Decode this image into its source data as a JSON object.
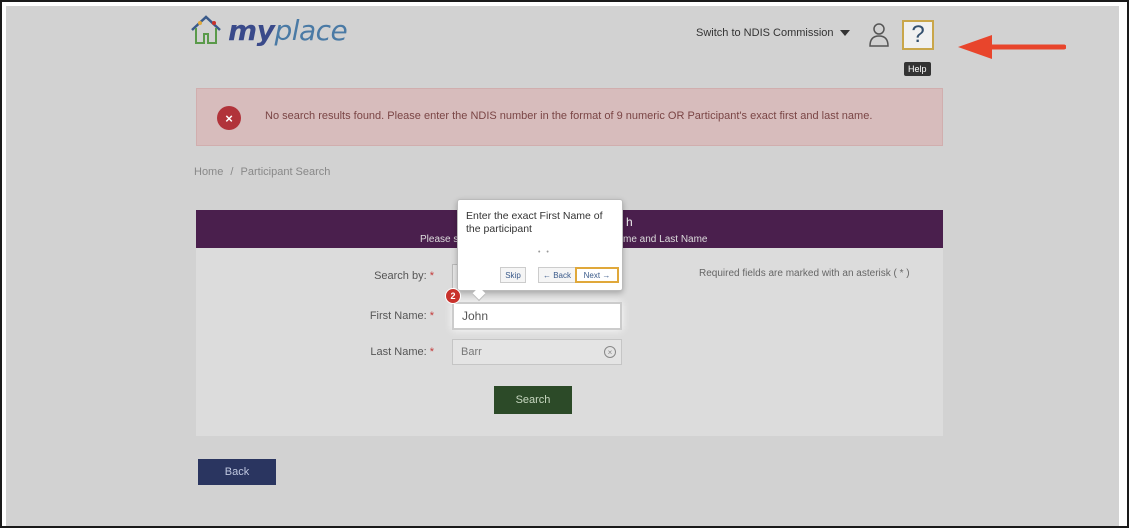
{
  "header": {
    "logo_prefix": "my",
    "logo_suffix": "place",
    "switch_label": "Switch to NDIS Commission",
    "help_symbol": "?",
    "help_tooltip": "Help",
    "user_icon": "user-icon",
    "annotation_arrow_color": "#e8452c"
  },
  "alert": {
    "icon": "×",
    "message": "No search results found. Please enter the NDIS number in the format of 9 numeric OR Participant's exact first and last name."
  },
  "breadcrumb": {
    "home": "Home",
    "separator": "/",
    "current": "Participant Search"
  },
  "card": {
    "header_title_fragment": "h",
    "header_sub_left": "Please se",
    "header_sub_right": "me and Last Name",
    "required_note": "Required fields are marked with an asterisk ( * )",
    "fields": {
      "search_by_label": "Search by:",
      "first_name_label": "First Name:",
      "first_name_value": "John",
      "last_name_label": "Last Name:",
      "last_name_value": "Barr",
      "asterisk": "*"
    },
    "search_button": "Search"
  },
  "back_button": "Back",
  "tour": {
    "step_number": "2",
    "text": "Enter the exact First Name of the participant",
    "dots": "• •",
    "skip": "Skip",
    "back": "← Back",
    "next": "Next →"
  },
  "colors": {
    "card_header": "#4a1f4d",
    "search_button": "#2c4a28",
    "back_button": "#2a3560",
    "alert_icon": "#b1333a",
    "help_border": "#c9a64a"
  }
}
